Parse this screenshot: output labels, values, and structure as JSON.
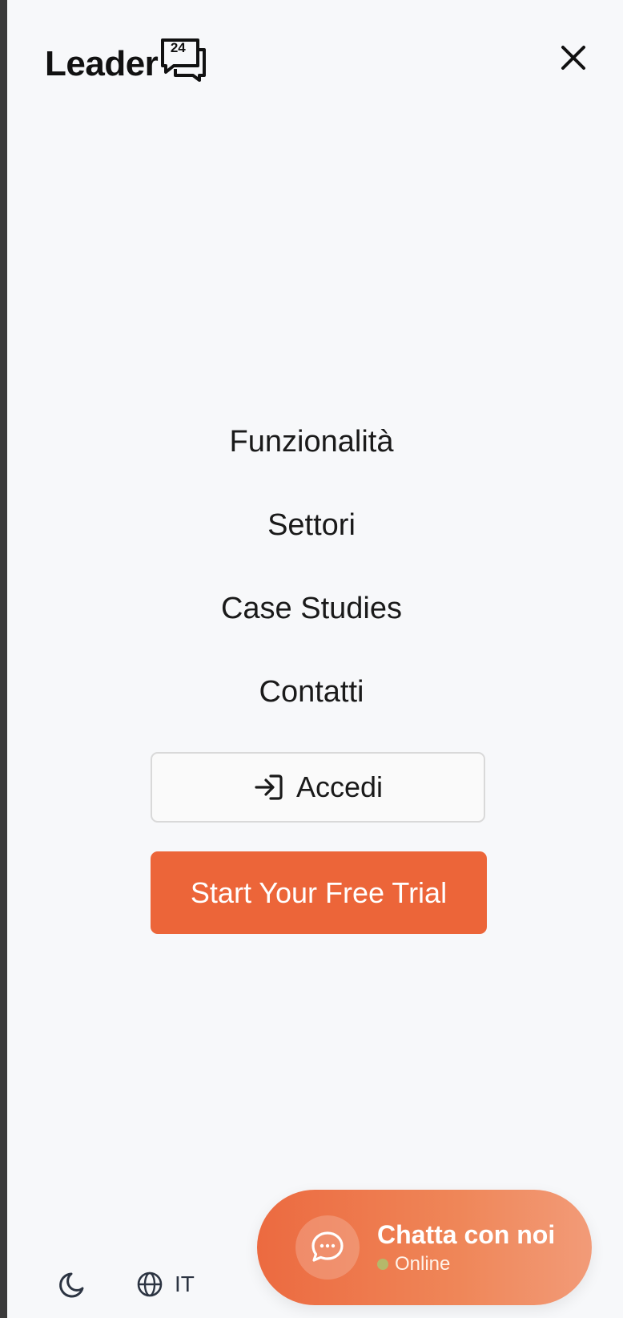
{
  "header": {
    "logo_text": "Leader",
    "logo_number": "24",
    "close_icon": "close-icon"
  },
  "nav": {
    "items": [
      {
        "label": "Funzionalità"
      },
      {
        "label": "Settori"
      },
      {
        "label": "Case Studies"
      },
      {
        "label": "Contatti"
      }
    ]
  },
  "actions": {
    "login_label": "Accedi",
    "login_icon": "login-arrow-icon",
    "trial_label": "Start Your Free Trial"
  },
  "footer": {
    "theme_icon": "moon-icon",
    "language_icon": "globe-icon",
    "language_label": "IT"
  },
  "chat": {
    "title": "Chatta con noi",
    "status": "Online",
    "icon": "chat-bubble-icon"
  },
  "colors": {
    "accent": "#ec6539",
    "background": "#f7f8fa",
    "text": "#1a1a1a",
    "status_dot": "#b5b86a"
  }
}
